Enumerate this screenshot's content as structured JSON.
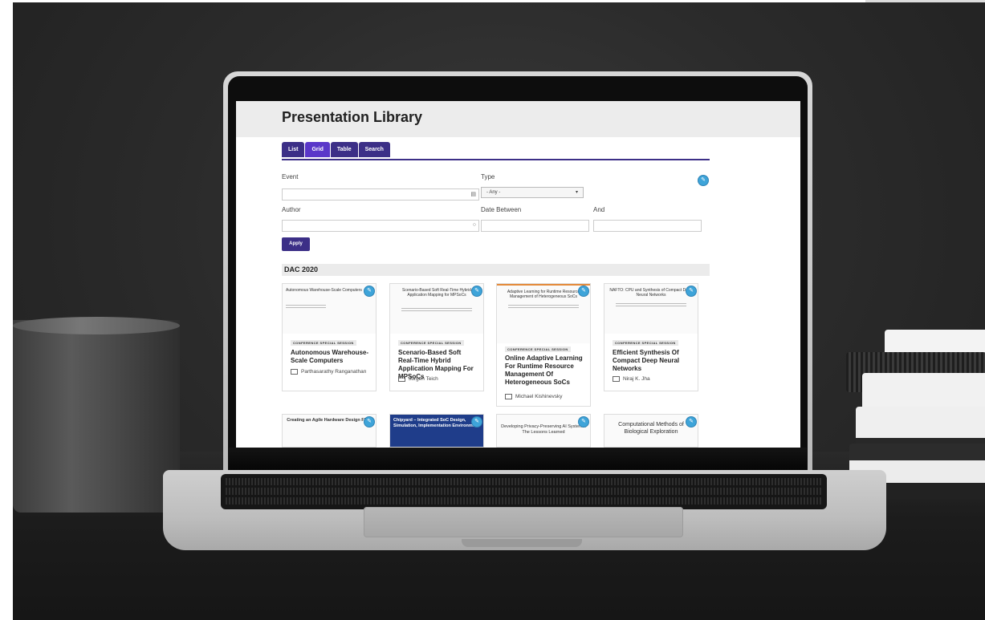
{
  "page": {
    "title": "Presentation Library"
  },
  "tabs": [
    {
      "label": "List"
    },
    {
      "label": "Grid"
    },
    {
      "label": "Table"
    },
    {
      "label": "Search"
    }
  ],
  "filters": {
    "event_label": "Event",
    "type_label": "Type",
    "type_selected": "- Any -",
    "author_label": "Author",
    "date_between_label": "Date Between",
    "and_label": "And",
    "apply_label": "Apply"
  },
  "section": {
    "title": "DAC 2020"
  },
  "cards": [
    {
      "thumb_title": "Autonomous Warehouse-Scale Computers",
      "badge": "Conference Special Session",
      "title": "Autonomous Warehouse-Scale Computers",
      "author": "Parthasarathy Ranganathan"
    },
    {
      "thumb_title": "Scenario-Based Soft Real-Time Hybrid Application Mapping for MPSoCs",
      "badge": "Conference Special Session",
      "title": "Scenario-Based Soft Real-Time Hybrid Application Mapping For MPSoCs",
      "author": "Jürgen Teich"
    },
    {
      "thumb_title": "Adaptive Learning for Runtime Resource Management of Heterogeneous SoCs",
      "badge": "Conference Special Session",
      "title": "Online Adaptive Learning For Runtime Resource Management Of Heterogeneous SoCs",
      "author": "Michael Kishinevsky"
    },
    {
      "thumb_title": "NAFTO: CPU and Synthesis of Compact Deep Neural Networks",
      "badge": "Conference Special Session",
      "title": "Efficient Synthesis Of Compact Deep Neural Networks",
      "author": "Niraj K. Jha"
    }
  ],
  "next_row": [
    {
      "thumb_title": "Creating an Agile Hardware Design Flow"
    },
    {
      "thumb_title": "Chipyard – Integrated SoC Design, Simulation, Implementation Environment"
    },
    {
      "thumb_title": "Developing Privacy-Preserving AI Systems: The Lessons Learned"
    },
    {
      "thumb_title": "Computational Methods of Biological Exploration"
    }
  ],
  "icons": {
    "edit": "pencil-icon",
    "calendar": "calendar-icon",
    "author": "person-icon"
  },
  "colors": {
    "brand_purple": "#3c2f87",
    "active_tab": "#5a37c9",
    "edit_blue": "#3ea4d9"
  }
}
